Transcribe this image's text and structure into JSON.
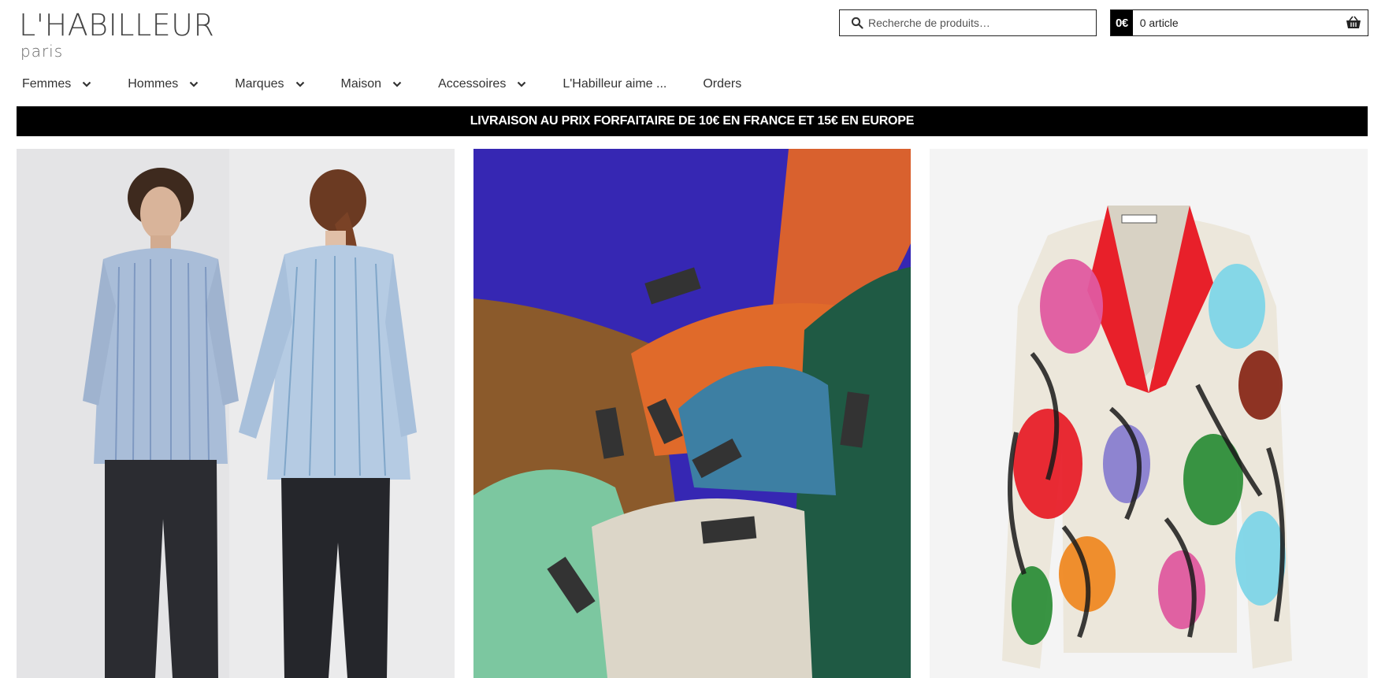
{
  "header": {
    "logo_main": "L'HABILLEUR",
    "logo_sub": "Paris",
    "search_placeholder": "Recherche de produits…",
    "cart_total": "0€",
    "cart_count": "0 article"
  },
  "nav": {
    "items": [
      {
        "label": "Femmes",
        "has_dropdown": true
      },
      {
        "label": "Hommes",
        "has_dropdown": true
      },
      {
        "label": "Marques",
        "has_dropdown": true
      },
      {
        "label": "Maison",
        "has_dropdown": true
      },
      {
        "label": "Accessoires",
        "has_dropdown": true
      },
      {
        "label": "L'Habilleur aime ...",
        "has_dropdown": false
      },
      {
        "label": "Orders",
        "has_dropdown": false
      }
    ]
  },
  "banner": {
    "text": "LIVRAISON AU PRIX FORFAITAIRE DE 10€ EN FRANCE ET 15€ EN EUROPE"
  },
  "colors": {
    "banner_bg": "#000000",
    "banner_text": "#ffffff",
    "text": "#222222"
  },
  "icons": {
    "search": "search-icon",
    "cart": "basket-icon",
    "dropdown": "chevron-down-icon"
  }
}
